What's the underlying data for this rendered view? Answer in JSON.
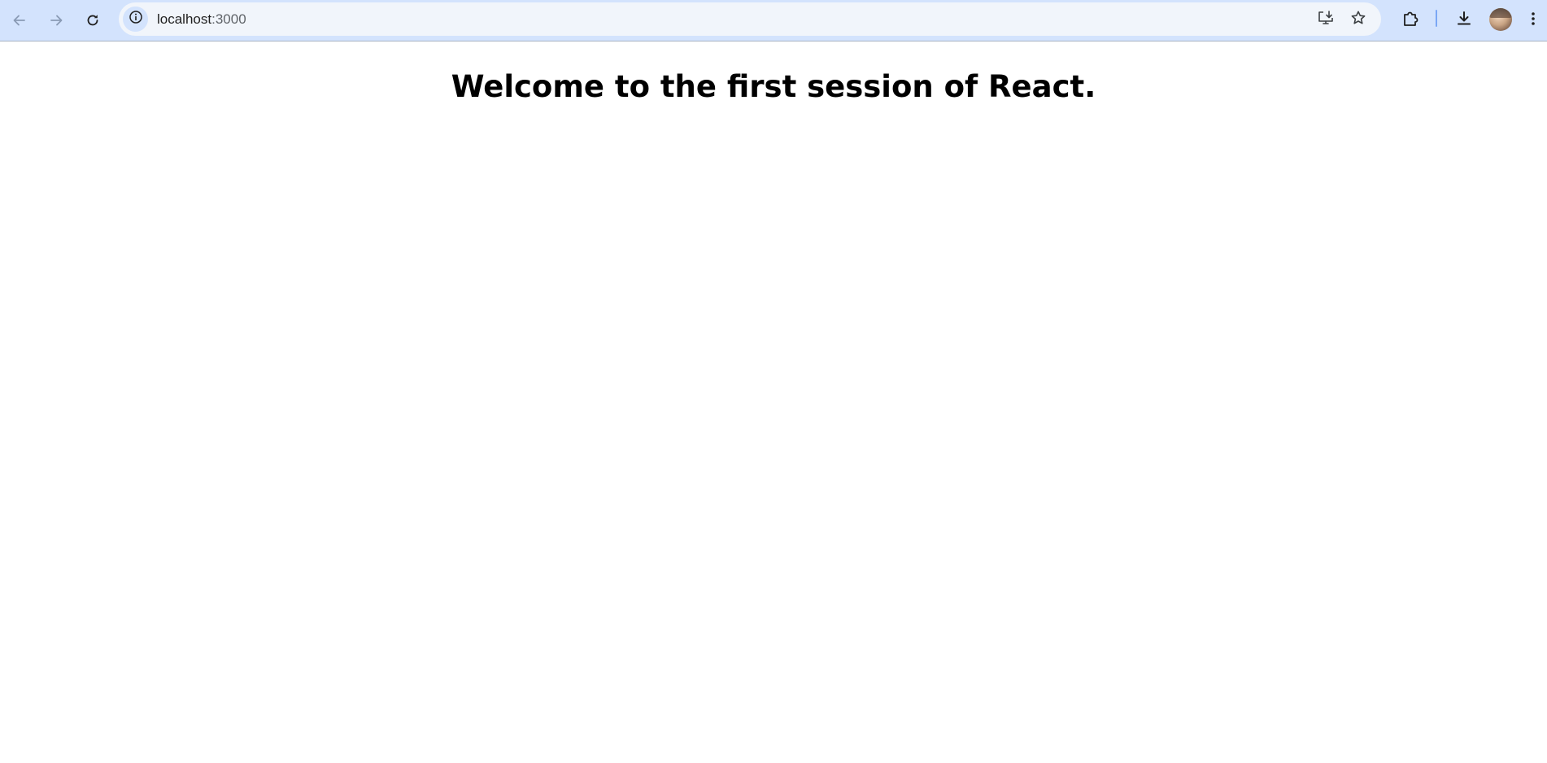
{
  "browser": {
    "url_host": "localhost",
    "url_port": ":3000",
    "icons": {
      "back": "arrow-left-icon",
      "forward": "arrow-right-icon",
      "reload": "reload-icon",
      "site_info": "info-icon",
      "install": "install-app-icon",
      "bookmark": "star-icon",
      "extensions": "puzzle-piece-icon",
      "downloads": "download-icon",
      "profile": "avatar",
      "menu": "kebab-menu-icon"
    },
    "colors": {
      "toolbar_background": "#d3e3fd",
      "omnibox_background": "#f1f5fb",
      "divider_accent": "#7aa7f5"
    }
  },
  "page": {
    "heading": "Welcome to the first session of React."
  }
}
